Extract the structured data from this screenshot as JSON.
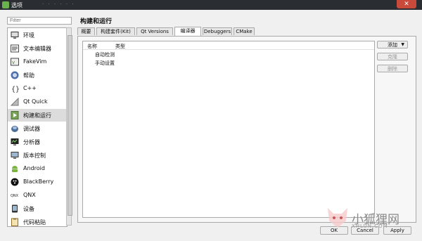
{
  "window": {
    "title": "选项",
    "menu_strip": "· · · · · ·",
    "close_label": "✕"
  },
  "filter": {
    "placeholder": "Filter"
  },
  "sidebar": {
    "items": [
      {
        "label": "环境",
        "icon": "monitor-icon"
      },
      {
        "label": "文本编辑器",
        "icon": "text-editor-icon"
      },
      {
        "label": "FakeVim",
        "icon": "fakevim-icon"
      },
      {
        "label": "帮助",
        "icon": "help-icon"
      },
      {
        "label": "C++",
        "icon": "cpp-braces-icon"
      },
      {
        "label": "Qt Quick",
        "icon": "qt-quick-icon"
      },
      {
        "label": "构建和运行",
        "icon": "build-run-icon"
      },
      {
        "label": "调试器",
        "icon": "debugger-icon"
      },
      {
        "label": "分析器",
        "icon": "analyzer-icon"
      },
      {
        "label": "版本控制",
        "icon": "version-control-icon"
      },
      {
        "label": "Android",
        "icon": "android-icon"
      },
      {
        "label": "BlackBerry",
        "icon": "blackberry-icon"
      },
      {
        "label": "QNX",
        "icon": "qnx-icon"
      },
      {
        "label": "设备",
        "icon": "device-icon"
      },
      {
        "label": "代码粘贴",
        "icon": "code-paste-icon"
      }
    ],
    "selected_index": 6
  },
  "page": {
    "title": "构建和运行"
  },
  "tabs": [
    {
      "label": "概要"
    },
    {
      "label": "构建套件(Kit)"
    },
    {
      "label": "Qt Versions"
    },
    {
      "label": "编译器"
    },
    {
      "label": "Debuggers"
    },
    {
      "label": "CMake"
    }
  ],
  "active_tab": 3,
  "tree": {
    "headers": [
      "名称",
      "类型"
    ],
    "rows": [
      "自动检测",
      "手动设置"
    ]
  },
  "buttons": {
    "add": "添加",
    "clone": "克隆",
    "remove": "删除"
  },
  "footer": {
    "ok": "OK",
    "cancel": "Cancel",
    "apply": "Apply"
  },
  "watermark": {
    "text": "小狐狸网",
    "url": "XHLUN.COM"
  },
  "colors": {
    "titlebar": "#2a2d31",
    "close": "#c94a3b",
    "selected_row": "#dcdcdc"
  }
}
